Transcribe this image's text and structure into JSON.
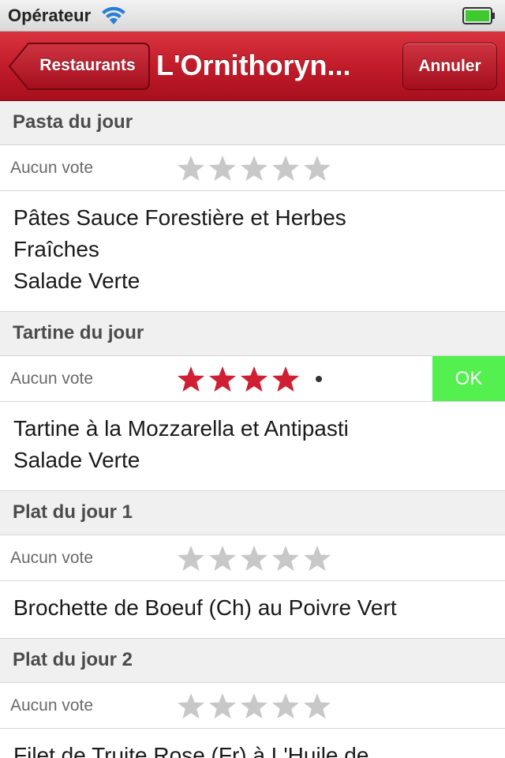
{
  "status": {
    "carrier": "Opérateur"
  },
  "nav": {
    "back_label": "Restaurants",
    "title": "L'Ornithoryn...",
    "cancel_label": "Annuler"
  },
  "colors": {
    "accent": "#c21c2a",
    "star_filled": "#d01e33",
    "star_empty": "#c8c8c8",
    "ok_green": "#54f050"
  },
  "sections": [
    {
      "header": "Pasta du jour",
      "vote_label": "Aucun vote",
      "rating": 0,
      "show_ok": false,
      "dish_lines": [
        "Pâtes Sauce Forestière et Herbes",
        "Fraîches",
        "Salade Verte"
      ]
    },
    {
      "header": "Tartine du jour",
      "vote_label": "Aucun vote",
      "rating": 4,
      "show_ok": true,
      "ok_label": "OK",
      "dish_lines": [
        "Tartine à la Mozzarella et Antipasti",
        "Salade Verte"
      ]
    },
    {
      "header": "Plat du jour 1",
      "vote_label": "Aucun vote",
      "rating": 0,
      "show_ok": false,
      "dish_lines": [
        "Brochette de Boeuf (Ch) au Poivre Vert"
      ]
    },
    {
      "header": "Plat du jour 2",
      "vote_label": "Aucun vote",
      "rating": 0,
      "show_ok": false,
      "dish_lines": [
        "Filet de Truite Rose (Fr) à L'Huile de"
      ]
    }
  ]
}
